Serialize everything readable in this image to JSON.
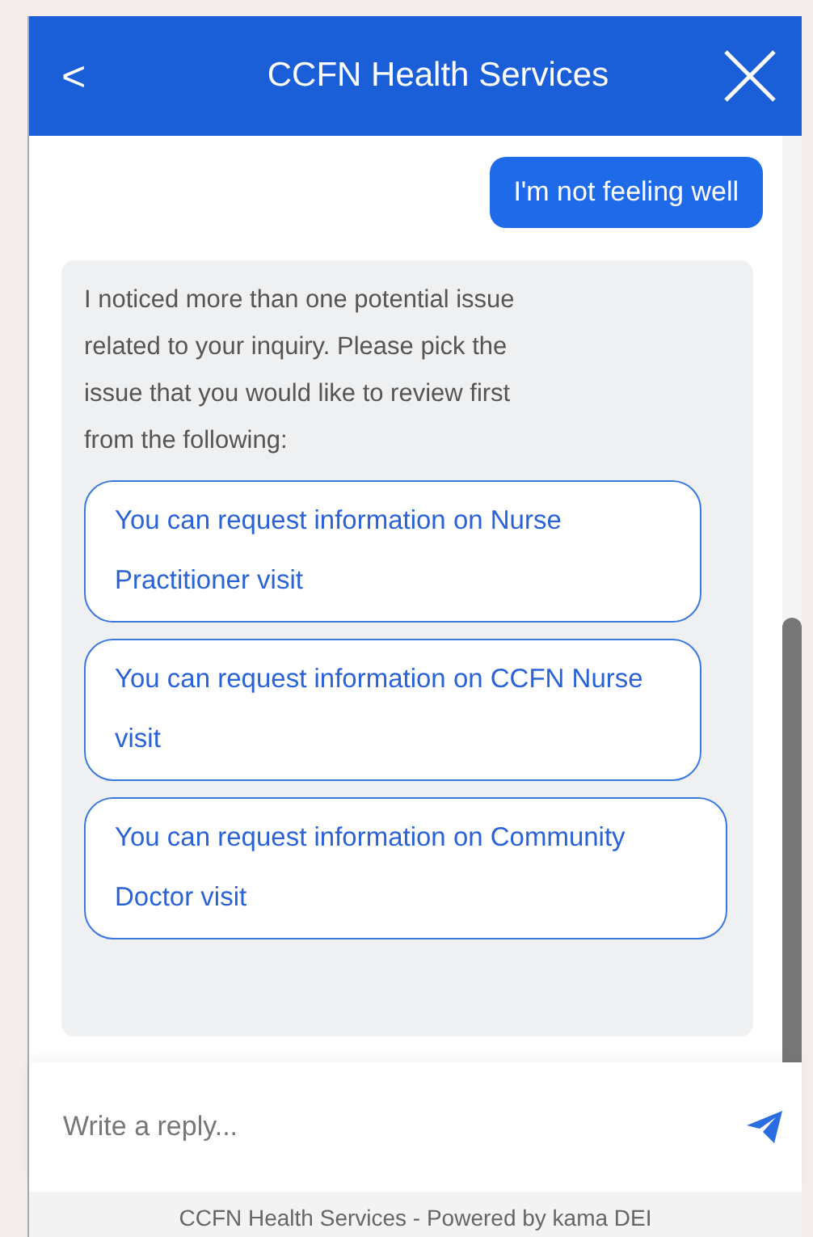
{
  "header": {
    "title": "CCFN Health Services",
    "back": "<"
  },
  "messages": [
    {
      "kind": "user",
      "text": "I'm not feeling well"
    },
    {
      "kind": "bot",
      "text": "I noticed more than one potential issue related to your inquiry. Please pick the issue that you would like to review first from the following:",
      "options": [
        "You can request information on Nurse Practitioner visit",
        "You can request information on CCFN Nurse visit",
        "You can request information on Community Doctor visit"
      ]
    }
  ],
  "composer": {
    "placeholder": "Write a reply..."
  },
  "footer": "CCFN Health Services - Powered by kama DEI"
}
